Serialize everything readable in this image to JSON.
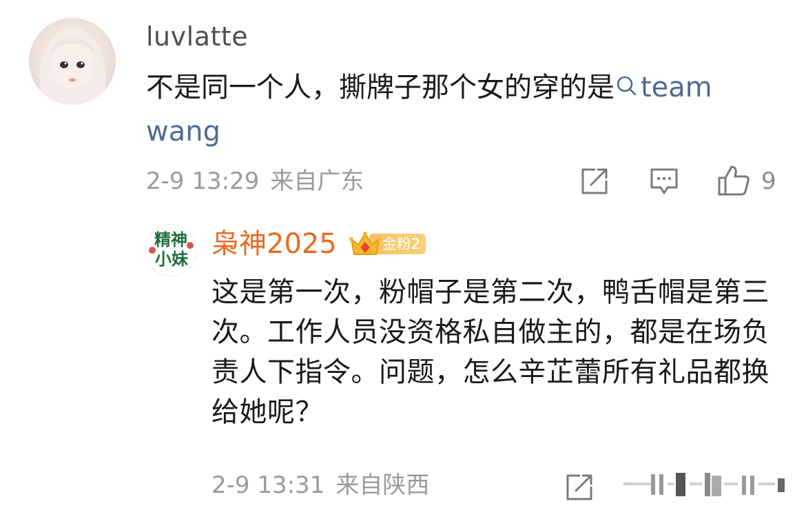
{
  "comment": {
    "username": "luvlatte",
    "text": "不是同一个人，撕牌子那个女的穿的是",
    "topic_link": "team wang",
    "timestamp": "2-9 13:29",
    "location": "来自广东",
    "likes": "9",
    "icons": [
      "share-icon",
      "reply-icon",
      "like-icon",
      "search-icon"
    ]
  },
  "reply": {
    "username": "枭神2025",
    "badge_label": "金粉2",
    "avatar_text_line1": "精神",
    "avatar_text_line2": "小妹",
    "text": "这是第一次，粉帽子是第二次，鸭舌帽是第三次。工作人员没资格私自做主的，都是在场负责人下指令。问题，怎么辛芷蕾所有礼品都换给她呢？",
    "timestamp": "2-9 13:31",
    "location": "来自陕西",
    "icons": [
      "share-icon",
      "crown-icon"
    ]
  },
  "colors": {
    "username_reply": "#ea6a1f",
    "topic_link": "#4f6a92",
    "meta": "#9a9a9a",
    "badge": "#f3c061"
  }
}
